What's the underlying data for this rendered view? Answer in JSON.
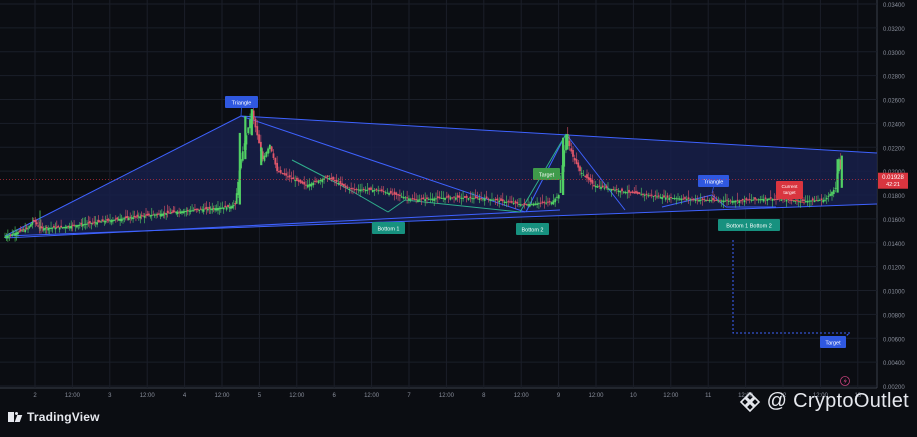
{
  "branding": {
    "platform": "TradingView",
    "watermark": "@ CryptoOutlet"
  },
  "colors": {
    "background": "#0b0d12",
    "triangle_lines": "#3e62ff",
    "triangle_fill": "#17204a",
    "candle_up": "#51d064",
    "candle_down": "#e0566a",
    "price_badge": "#d9353f",
    "label_blue": "#2f58e0",
    "label_teal": "#17917f",
    "label_green": "#3f9b4a",
    "label_red": "#d9353f"
  },
  "price_axis": {
    "ticks": [
      "0.03400",
      "0.03200",
      "0.03000",
      "0.02800",
      "0.02600",
      "0.02400",
      "0.02200",
      "0.02000",
      "0.01800",
      "0.01600",
      "0.01400",
      "0.01200",
      "0.01000",
      "0.00800",
      "0.00600",
      "0.00400",
      "0.00200"
    ],
    "current_price": "0.01928",
    "countdown": "42:21"
  },
  "time_axis": {
    "ticks": [
      "2",
      "12:00",
      "3",
      "12:00",
      "4",
      "12:00",
      "5",
      "12:00",
      "6",
      "12:00",
      "7",
      "12:00",
      "8",
      "12:00",
      "9",
      "12:00",
      "10",
      "12:00",
      "11",
      "12:00",
      "12",
      "12:00",
      "13"
    ]
  },
  "annotations": [
    {
      "text": "Triangle",
      "color": "blue"
    },
    {
      "text": "Target",
      "color": "green"
    },
    {
      "text": "Triangle",
      "color": "blue"
    },
    {
      "text": "Current target",
      "color": "red"
    },
    {
      "text": "Bottom 1",
      "color": "teal"
    },
    {
      "text": "Bottom 2",
      "color": "teal"
    },
    {
      "text": "Bottom 1 Bottom 2",
      "color": "teal"
    },
    {
      "text": "Target",
      "color": "blue"
    }
  ],
  "chart_data": {
    "type": "candlestick",
    "ylim": [
      0.002,
      0.034
    ],
    "grid": true,
    "close_path": [
      {
        "x": 0,
        "y": 0.0145
      },
      {
        "x": 0.4,
        "y": 0.0152
      },
      {
        "x": 0.5,
        "y": 0.0159
      },
      {
        "x": 0.6,
        "y": 0.0152
      },
      {
        "x": 1.0,
        "y": 0.0153
      },
      {
        "x": 2.0,
        "y": 0.016
      },
      {
        "x": 3.0,
        "y": 0.0166
      },
      {
        "x": 3.9,
        "y": 0.017
      },
      {
        "x": 4.0,
        "y": 0.0172
      },
      {
        "x": 4.1,
        "y": 0.021
      },
      {
        "x": 4.25,
        "y": 0.025
      },
      {
        "x": 4.4,
        "y": 0.021
      },
      {
        "x": 4.5,
        "y": 0.0222
      },
      {
        "x": 4.6,
        "y": 0.02
      },
      {
        "x": 5.0,
        "y": 0.0188
      },
      {
        "x": 5.3,
        "y": 0.0195
      },
      {
        "x": 5.6,
        "y": 0.0185
      },
      {
        "x": 6.0,
        "y": 0.0184
      },
      {
        "x": 6.5,
        "y": 0.0176
      },
      {
        "x": 7.0,
        "y": 0.0178
      },
      {
        "x": 7.5,
        "y": 0.0177
      },
      {
        "x": 8.0,
        "y": 0.0172
      },
      {
        "x": 8.4,
        "y": 0.0174
      },
      {
        "x": 8.5,
        "y": 0.018
      },
      {
        "x": 8.6,
        "y": 0.023
      },
      {
        "x": 8.7,
        "y": 0.0212
      },
      {
        "x": 8.8,
        "y": 0.02
      },
      {
        "x": 9.0,
        "y": 0.0188
      },
      {
        "x": 9.5,
        "y": 0.0182
      },
      {
        "x": 10.0,
        "y": 0.0178
      },
      {
        "x": 10.5,
        "y": 0.0176
      },
      {
        "x": 11.0,
        "y": 0.0175
      },
      {
        "x": 11.5,
        "y": 0.0177
      },
      {
        "x": 12.0,
        "y": 0.0175
      },
      {
        "x": 12.3,
        "y": 0.0176
      },
      {
        "x": 12.45,
        "y": 0.0186
      },
      {
        "x": 12.5,
        "y": 0.021
      },
      {
        "x": 12.55,
        "y": 0.0193
      }
    ]
  }
}
